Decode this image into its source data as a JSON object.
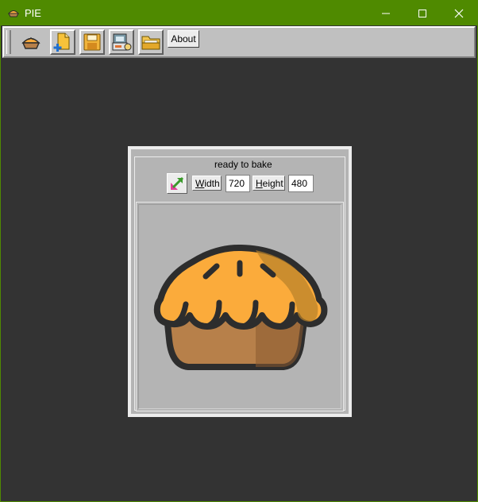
{
  "window": {
    "title": "PIE",
    "controls": [
      "minimize-icon",
      "maximize-icon",
      "close-icon"
    ]
  },
  "toolbar": {
    "buttons": [
      "pie-icon",
      "new-file-icon",
      "save-icon",
      "bake-icon",
      "open-folder-icon"
    ],
    "about_label": "About"
  },
  "panel": {
    "group_label": "ready to bake",
    "width_label_first": "W",
    "width_label_rest": "idth",
    "width_value": "720",
    "height_label_first": "H",
    "height_label_rest": "eight",
    "height_value": "480"
  },
  "colors": {
    "titlebar": "#4f8a00",
    "workspace": "#333333",
    "pie_top": "#fbab3b",
    "pie_crust": "#b7804a",
    "outline": "#2d2d2d"
  }
}
